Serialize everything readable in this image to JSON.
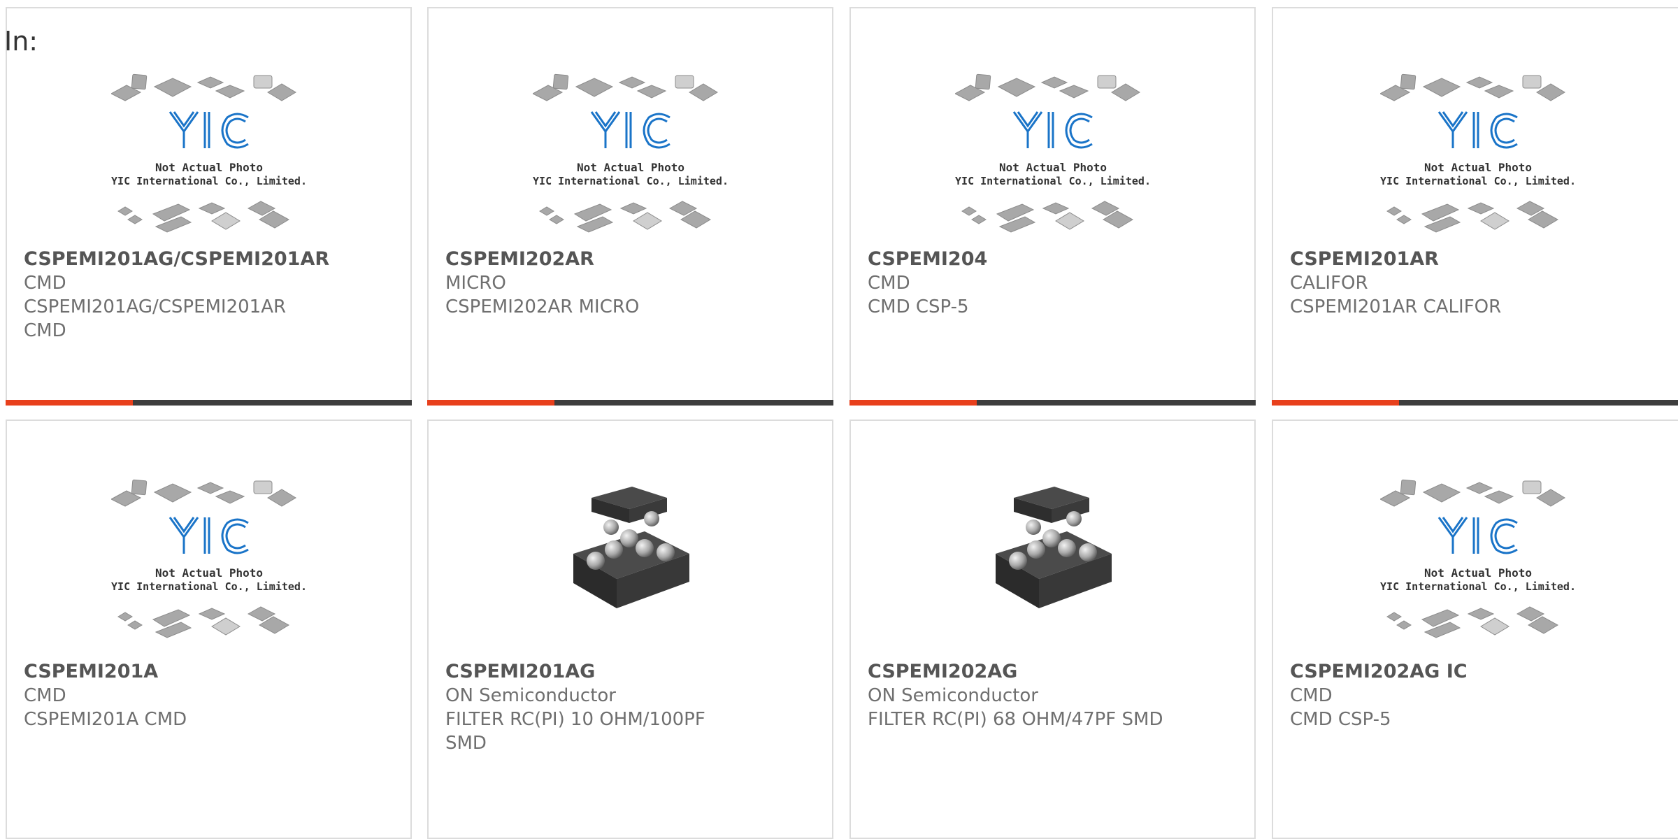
{
  "header": {
    "in_label": "In:"
  },
  "colors": {
    "accent": "#e8401c",
    "bar": "#3d3d3d",
    "logo": "#1a74c8"
  },
  "placeholder_image": {
    "line1": "Not Actual Photo",
    "line2": "YIC International Co., Limited.",
    "logo_text": "YIC"
  },
  "products": [
    {
      "part": "CSPEMI201AG/CSPEMI201AR",
      "maker": "CMD",
      "desc": "CSPEMI201AG/CSPEMI201AR",
      "desc2": "CMD",
      "image": "yic-placeholder"
    },
    {
      "part": "CSPEMI202AR",
      "maker": "MICRO",
      "desc": "CSPEMI202AR MICRO",
      "desc2": "",
      "image": "yic-placeholder"
    },
    {
      "part": "CSPEMI204",
      "maker": "CMD",
      "desc": "CMD CSP-5",
      "desc2": "",
      "image": "yic-placeholder"
    },
    {
      "part": "CSPEMI201AR",
      "maker": "CALIFOR",
      "desc": "CSPEMI201AR CALIFOR",
      "desc2": "",
      "image": "yic-placeholder"
    },
    {
      "part": "CSPEMI201A",
      "maker": "CMD",
      "desc": "CSPEMI201A CMD",
      "desc2": "",
      "image": "yic-placeholder"
    },
    {
      "part": "CSPEMI201AG",
      "maker": "ON Semiconductor",
      "desc": "FILTER RC(PI) 10 OHM/100PF",
      "desc2": "SMD",
      "image": "csp-package"
    },
    {
      "part": "CSPEMI202AG",
      "maker": "ON Semiconductor",
      "desc": "FILTER RC(PI) 68 OHM/47PF SMD",
      "desc2": "",
      "image": "csp-package"
    },
    {
      "part": "CSPEMI202AG IC",
      "maker": "CMD",
      "desc": "CMD CSP-5",
      "desc2": "",
      "image": "yic-placeholder"
    }
  ]
}
